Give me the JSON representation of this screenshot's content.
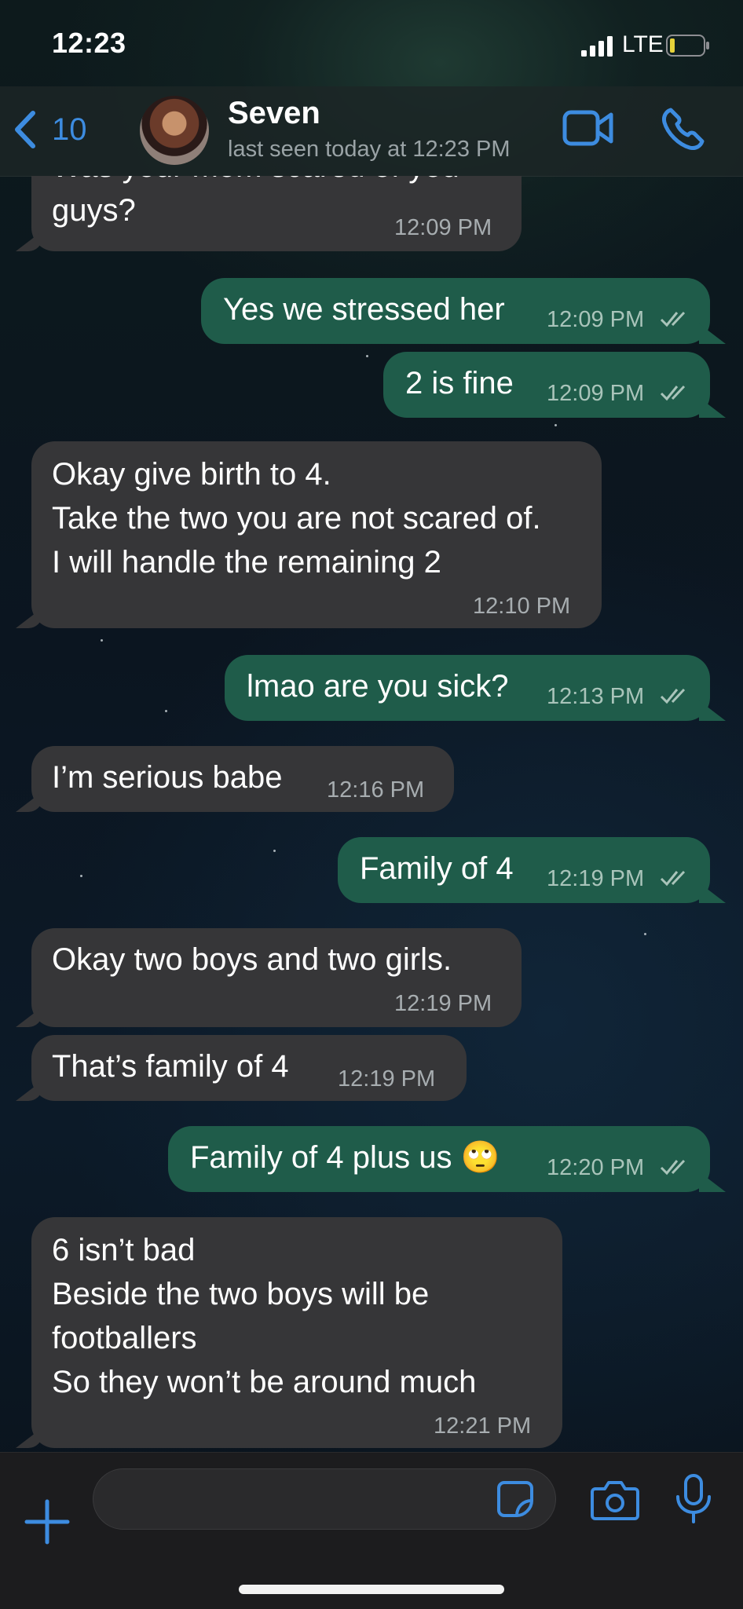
{
  "status_bar": {
    "time": "12:23",
    "network": "LTE"
  },
  "header": {
    "back_count": "10",
    "contact_name": "Seven",
    "last_seen": "last seen today at 12:23 PM"
  },
  "messages": [
    {
      "dir": "in",
      "text": "Was your mom scared of you\nguys?",
      "time": "12:09 PM"
    },
    {
      "dir": "out",
      "text": "Yes we stressed her",
      "time": "12:09 PM"
    },
    {
      "dir": "out",
      "text": "2 is fine",
      "time": "12:09 PM"
    },
    {
      "dir": "in",
      "text": "Okay give birth to 4.\nTake the two you are not scared of.\nI will handle the remaining 2",
      "time": "12:10 PM"
    },
    {
      "dir": "out",
      "text": "lmao are you sick?",
      "time": "12:13 PM"
    },
    {
      "dir": "in",
      "text": "I’m serious babe",
      "time": "12:16 PM"
    },
    {
      "dir": "out",
      "text": "Family of 4",
      "time": "12:19 PM"
    },
    {
      "dir": "in",
      "text": "Okay two boys and two girls.",
      "time": "12:19 PM"
    },
    {
      "dir": "in",
      "text": "That’s family of 4",
      "time": "12:19 PM"
    },
    {
      "dir": "out",
      "text": "Family of 4 plus us 🙄",
      "time": "12:20 PM"
    },
    {
      "dir": "in",
      "text": "6 isn’t bad\nBeside the two boys will be\nfootballers\nSo they won’t be around much",
      "time": "12:21 PM"
    }
  ],
  "composer": {
    "value": "",
    "placeholder": ""
  },
  "icons": {
    "back": "chevron-left-icon",
    "video": "video-camera-icon",
    "call": "phone-icon",
    "plus": "plus-icon",
    "sticker": "sticker-icon",
    "camera": "camera-icon",
    "mic": "microphone-icon",
    "read": "double-check-icon"
  },
  "colors": {
    "accent": "#3d8ce0",
    "outgoing_bubble": "#1f5c4a",
    "incoming_bubble": "#363638",
    "battery_level": "#e6d23a"
  }
}
